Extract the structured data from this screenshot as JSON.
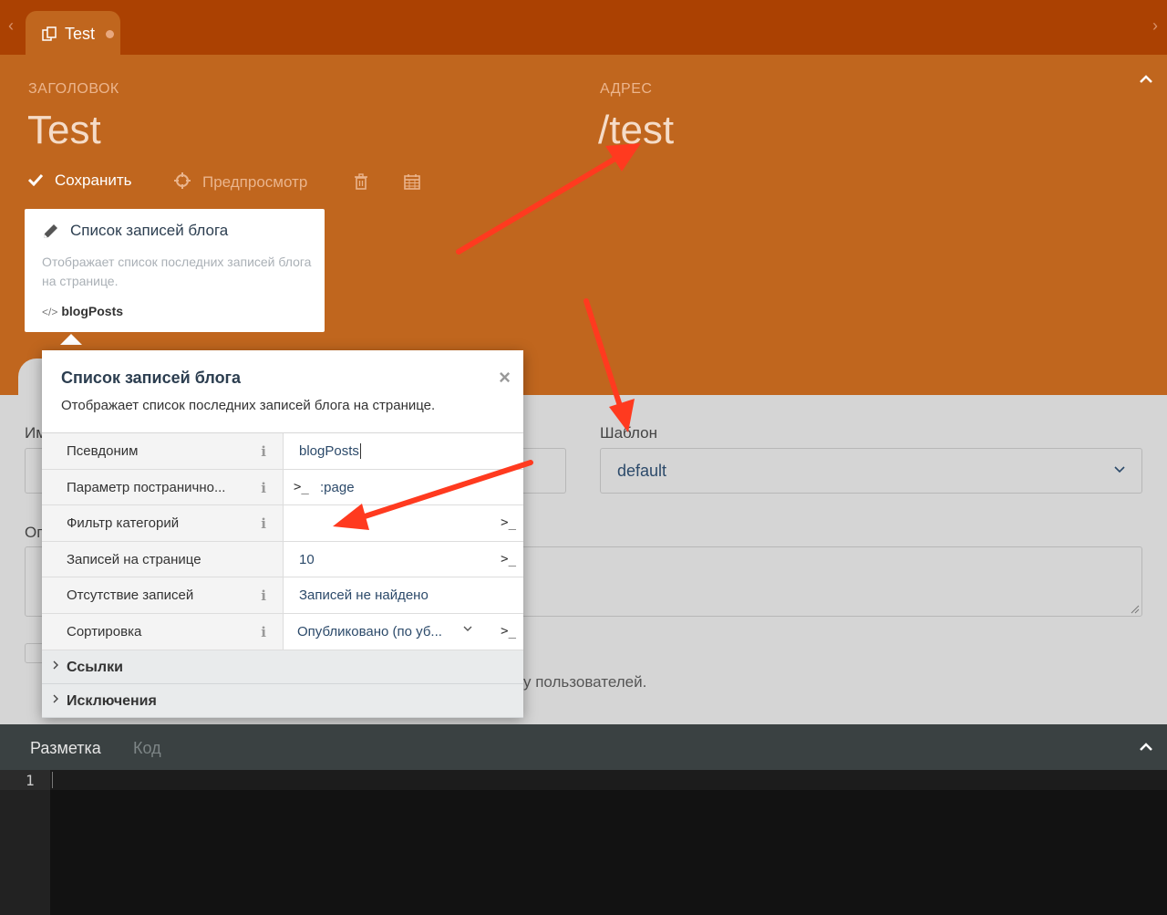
{
  "tabbar": {
    "tab_label": "Test",
    "nav_left": "‹",
    "nav_right": "›"
  },
  "header": {
    "title_caption": "ЗАГОЛОВОК",
    "title_value": "Test",
    "url_caption": "АДРЕС",
    "url_value": "/test",
    "save_label": "Сохранить",
    "preview_label": "Предпросмотр"
  },
  "component_card": {
    "title": "Список записей блога",
    "description": "Отображает список последних записей блога на странице.",
    "alias": "blogPosts",
    "alias_icon": "</>"
  },
  "form": {
    "name_label_partial": "Им",
    "description_label_partial": "Оп",
    "layout_label": "Шаблон",
    "layout_value": "default",
    "hidden_hint_partial": "у пользователей."
  },
  "popup": {
    "title": "Список записей блога",
    "description": "Отображает список последних записей блога на странице.",
    "close": "×",
    "properties": [
      {
        "name": "Псевдоним",
        "value": "blogPosts",
        "info": "i"
      },
      {
        "name": "Параметр постранично...",
        "value": ":page",
        "info": "i"
      },
      {
        "name": "Фильтр категорий",
        "value": "",
        "info": "i"
      },
      {
        "name": "Записей на странице",
        "value": "10"
      },
      {
        "name": "Отсутствие записей",
        "value": "Записей не найдено",
        "info": "i"
      },
      {
        "name": "Сортировка",
        "value": "Опубликовано (по уб...",
        "info": "i"
      }
    ],
    "groups": [
      {
        "label": "Ссылки"
      },
      {
        "label": "Исключения"
      }
    ],
    "terminal_icon": ">_"
  },
  "editor": {
    "tab_markup": "Разметка",
    "tab_code": "Код",
    "line_number": "1"
  },
  "colors": {
    "tabbar_bg": "#ab4102",
    "header_bg": "#c0661e",
    "annotation_arrow": "#ff3a1f"
  }
}
